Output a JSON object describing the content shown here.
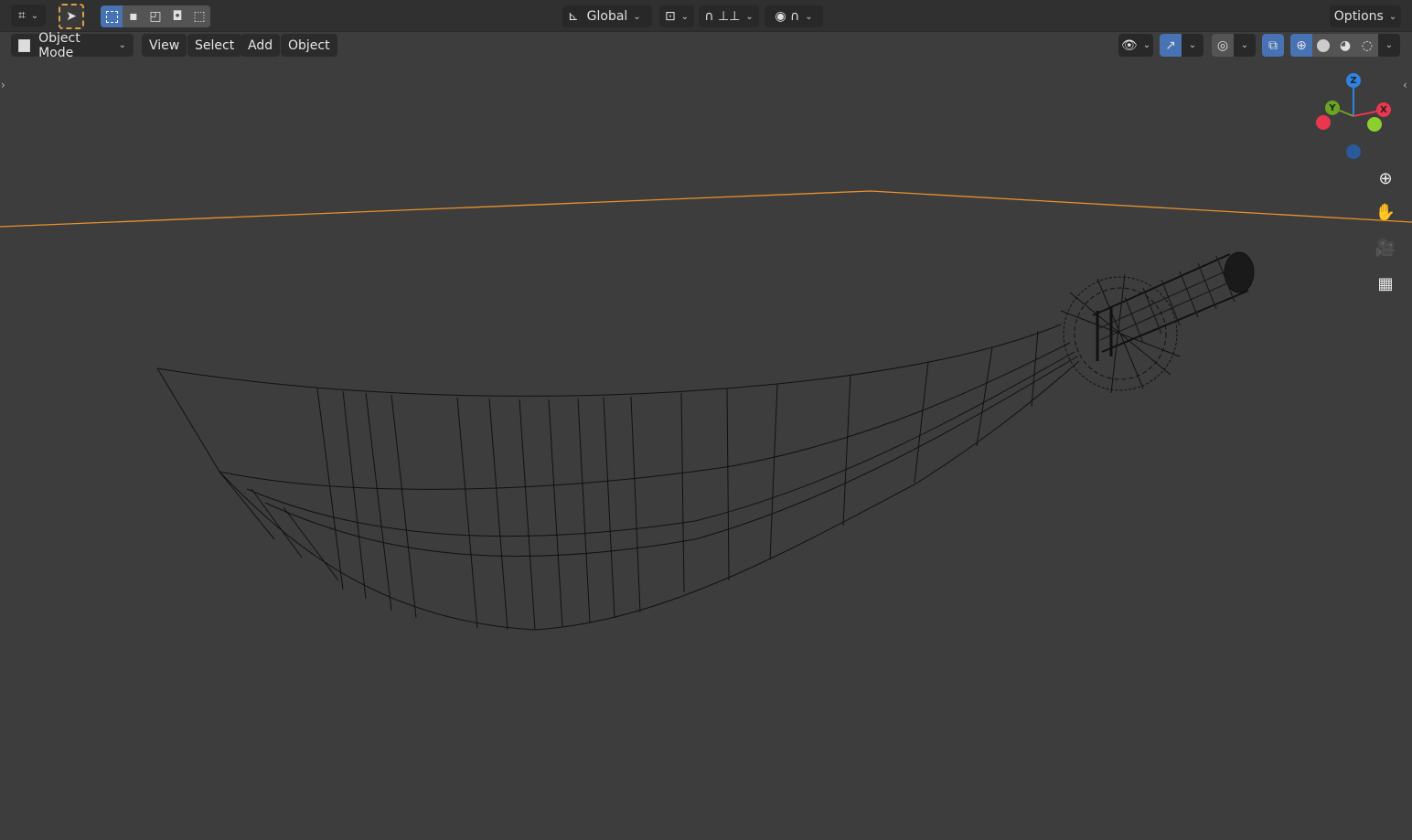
{
  "header": {
    "transform_orientation": "Global",
    "options_label": "Options"
  },
  "menubar": {
    "mode": "Object Mode",
    "items": [
      "View",
      "Select",
      "Add",
      "Object"
    ]
  },
  "gizmo": {
    "x": "X",
    "y": "Y",
    "z": "Z"
  },
  "colors": {
    "accent": "#4772b3",
    "selection_outline": "#f5a623",
    "x_axis": "#e8374f",
    "y_axis": "#6ba324",
    "z_axis": "#2f84e3"
  }
}
